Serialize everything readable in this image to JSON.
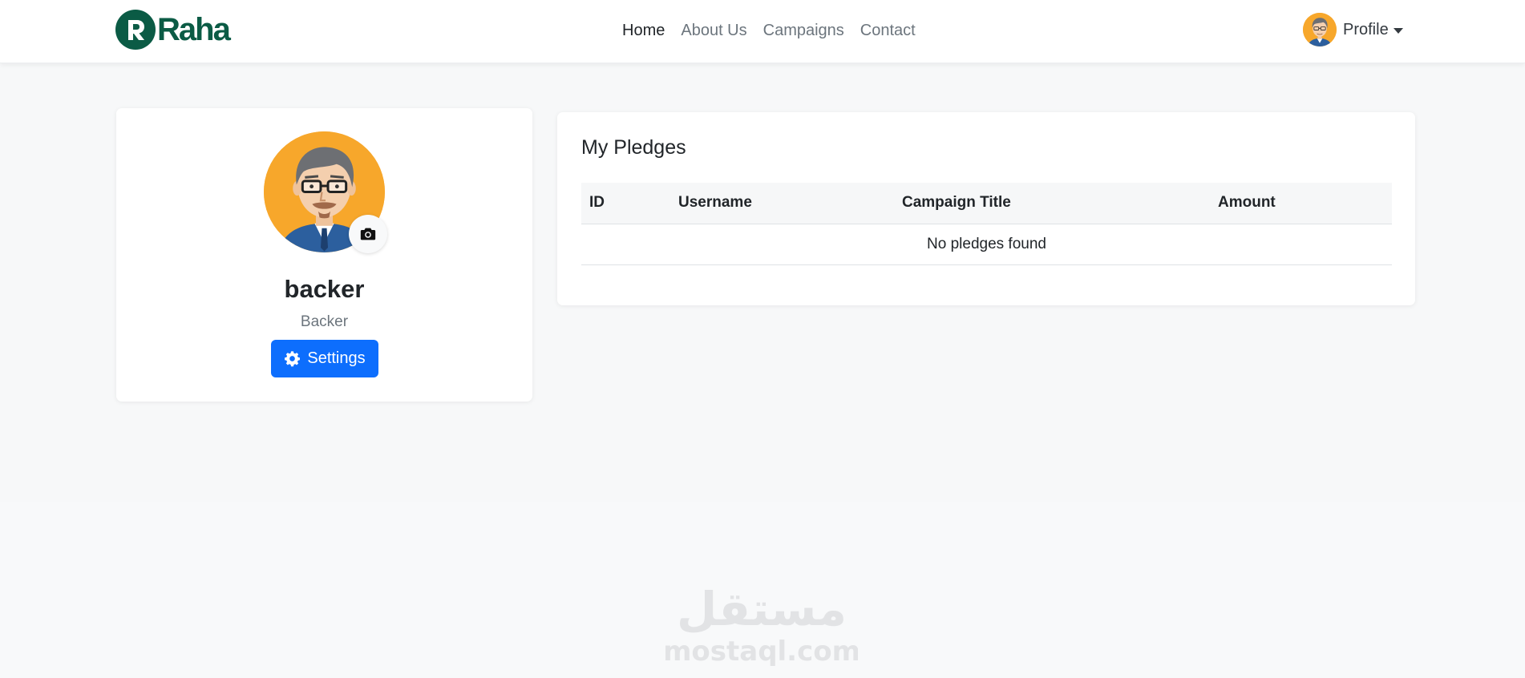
{
  "brand": {
    "name": "Raha",
    "color": "#0b5b45"
  },
  "nav": {
    "links": [
      {
        "label": "Home",
        "active": true
      },
      {
        "label": "About Us",
        "active": false
      },
      {
        "label": "Campaigns",
        "active": false
      },
      {
        "label": "Contact",
        "active": false
      }
    ],
    "profile_label": "Profile"
  },
  "profile_card": {
    "username": "backer",
    "role": "Backer",
    "settings_label": "Settings"
  },
  "pledges": {
    "title": "My Pledges",
    "columns": [
      "ID",
      "Username",
      "Campaign Title",
      "Amount"
    ],
    "empty_message": "No pledges found"
  },
  "footer": {
    "watermark_arabic": "مستقل",
    "watermark_latin": "mostaql.com"
  },
  "colors": {
    "primary": "#0d6efd",
    "avatar_bg": "#f7a72b",
    "page_bg": "#f8f9fa"
  },
  "icons": [
    "brand-logo-icon",
    "caret-down-icon",
    "camera-icon",
    "gear-icon"
  ]
}
